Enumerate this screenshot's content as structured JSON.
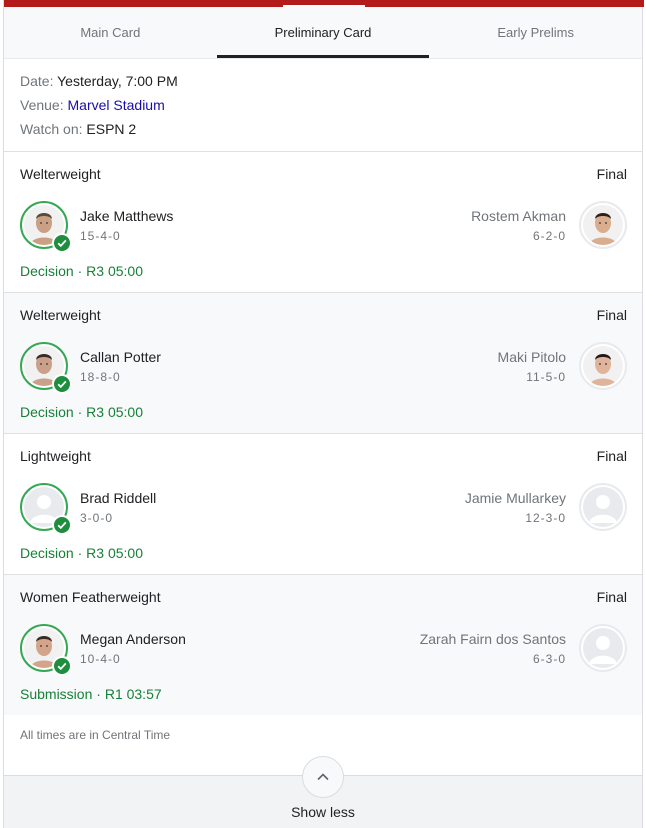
{
  "tabs": [
    {
      "label": "Main Card",
      "active": false
    },
    {
      "label": "Preliminary Card",
      "active": true
    },
    {
      "label": "Early Prelims",
      "active": false
    }
  ],
  "event": {
    "date_label": "Date:",
    "date_value": "Yesterday, 7:00 PM",
    "venue_label": "Venue:",
    "venue_value": "Marvel Stadium",
    "watch_label": "Watch on:",
    "watch_value": "ESPN 2"
  },
  "bouts": [
    {
      "division": "Welterweight",
      "status": "Final",
      "winner": {
        "name": "Jake Matthews",
        "record": "15-4-0",
        "photo": "photo"
      },
      "loser": {
        "name": "Rostem Akman",
        "record": "6-2-0",
        "photo": "photo"
      },
      "result_method": "Decision",
      "result_detail": "R3 05:00"
    },
    {
      "division": "Welterweight",
      "status": "Final",
      "winner": {
        "name": "Callan Potter",
        "record": "18-8-0",
        "photo": "photo"
      },
      "loser": {
        "name": "Maki Pitolo",
        "record": "11-5-0",
        "photo": "photo"
      },
      "result_method": "Decision",
      "result_detail": "R3 05:00"
    },
    {
      "division": "Lightweight",
      "status": "Final",
      "winner": {
        "name": "Brad Riddell",
        "record": "3-0-0",
        "photo": "placeholder"
      },
      "loser": {
        "name": "Jamie Mullarkey",
        "record": "12-3-0",
        "photo": "placeholder"
      },
      "result_method": "Decision",
      "result_detail": "R3 05:00"
    },
    {
      "division": "Women Featherweight",
      "status": "Final",
      "winner": {
        "name": "Megan Anderson",
        "record": "10-4-0",
        "photo": "photo"
      },
      "loser": {
        "name": "Zarah Fairn dos Santos",
        "record": "6-3-0",
        "photo": "placeholder"
      },
      "result_method": "Submission",
      "result_detail": "R1 03:57"
    }
  ],
  "footer": {
    "timezone_note": "All times are in Central Time",
    "show_less_label": "Show less"
  },
  "colors": {
    "accent_bar": "#b31b1b",
    "winner_green": "#34a853",
    "result_text": "#188038",
    "venue_link": "#1a0dab"
  },
  "icons": {
    "winner_badge": "check-icon",
    "collapse": "chevron-up-icon",
    "no_photo": "person-placeholder-icon"
  }
}
